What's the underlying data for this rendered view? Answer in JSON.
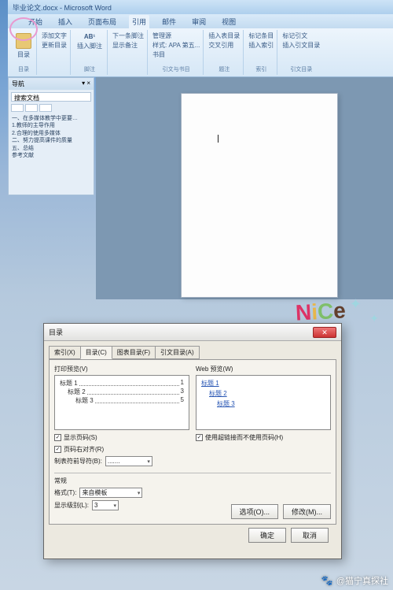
{
  "title_bar": {
    "doc": "毕业论文.docx",
    "app": "Microsoft Word"
  },
  "tabs": {
    "file": "开始",
    "insert": "插入",
    "layout": "页面布局",
    "references": "引用",
    "mail": "邮件",
    "review": "审阅",
    "view": "视图"
  },
  "ribbon": {
    "toc_btn": "目录",
    "add_text": "添加文字",
    "update_toc": "更新目录",
    "toc_group": "目录",
    "ab1": "AB¹",
    "insert_footnote": "插入脚注",
    "next_footnote": "下一条脚注",
    "show_notes": "显示备注",
    "footnote_group": "脚注",
    "insert_citation": "插入引文",
    "manage_sources": "管理源",
    "style_label": "样式: APA 第五...",
    "bibliography": "书目",
    "citations_group": "引文与书目",
    "insert_caption": "插入题注",
    "insert_tof": "插入表目录",
    "cross_ref": "交叉引用",
    "caption_group": "题注",
    "mark_entry": "标记条目",
    "insert_index": "插入索引",
    "index_group": "索引",
    "mark_citation": "标记引文",
    "insert_toa": "插入引文目录",
    "toa_group": "引文目录"
  },
  "nav": {
    "title": "导航",
    "search_ph": "搜索文档",
    "items": [
      "一、在多媒体教学中更要…",
      "  1.教师的主导作用",
      "  2.合理的使用多媒体",
      "二、努力提高课件的质量",
      "五、总结",
      "参考文献"
    ]
  },
  "sticker": {
    "text": "NiCe"
  },
  "dialog": {
    "title": "目录",
    "tabs": {
      "index": "索引(X)",
      "toc": "目录(C)",
      "figures": "图表目录(F)",
      "authorities": "引文目录(A)"
    },
    "print_preview_label": "打印预览(V)",
    "web_preview_label": "Web 预览(W)",
    "toc_preview": [
      {
        "title": "标题 1",
        "page": "1",
        "indent": 0
      },
      {
        "title": "标题 2",
        "page": "3",
        "indent": 1
      },
      {
        "title": "标题 3",
        "page": "5",
        "indent": 2
      }
    ],
    "web_links": [
      "标题 1",
      "标题 2",
      "标题 3"
    ],
    "show_pages": "显示页码(S)",
    "right_align": "页码右对齐(R)",
    "use_hyperlinks": "使用超链接而不使用页码(H)",
    "tab_leader_label": "制表符前导符(B):",
    "tab_leader_value": ".......",
    "general_label": "常规",
    "format_label": "格式(T):",
    "format_value": "来自模板",
    "levels_label": "显示级别(L):",
    "levels_value": "3",
    "options_btn": "选项(O)...",
    "modify_btn": "修改(M)...",
    "ok": "确定",
    "cancel": "取消"
  },
  "watermark": "@猫宁真探社"
}
